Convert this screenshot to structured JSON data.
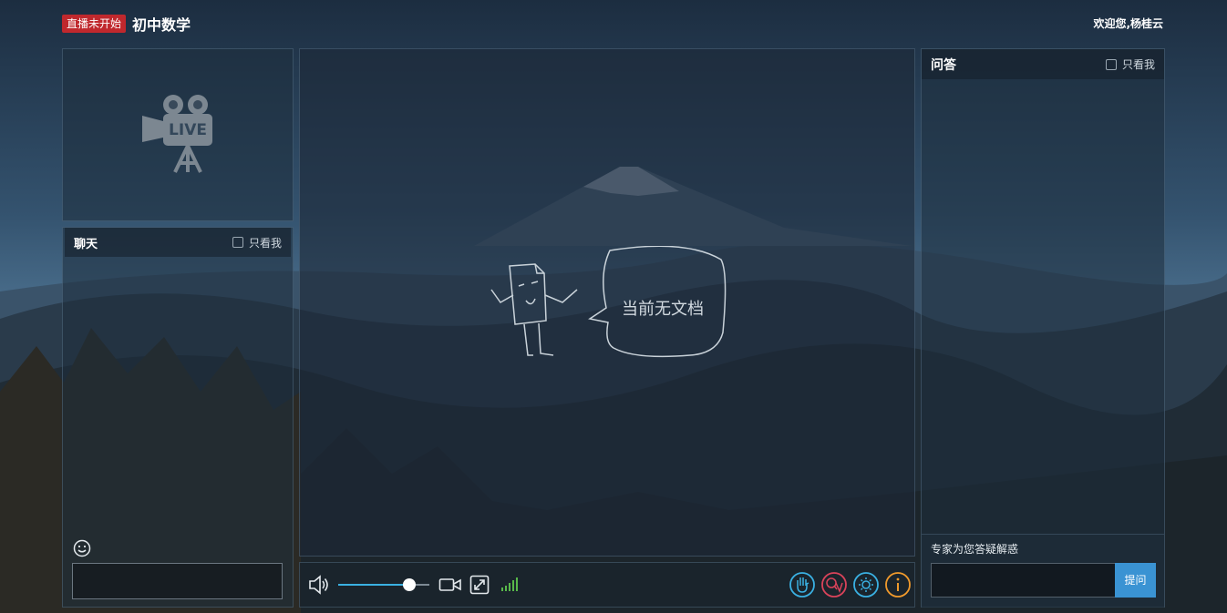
{
  "header": {
    "status_badge": "直播未开始",
    "course_title": "初中数学",
    "welcome": "欢迎您,杨桂云"
  },
  "video": {
    "icon": "live-camera-icon",
    "icon_text": "LIVE"
  },
  "chat": {
    "title": "聊天",
    "only_me_label": "只看我",
    "only_me_checked": false,
    "input_value": "",
    "emoji_icon": "smiley-icon"
  },
  "document": {
    "empty_text": "当前无文档",
    "illustration": "document-character-icon"
  },
  "controls": {
    "volume_level": 0.78,
    "icons": [
      "speaker-icon",
      "camera-icon",
      "fullscreen-icon",
      "signal-icon"
    ],
    "action_icons": [
      "raise-hand-icon",
      "qa-icon",
      "brightness-icon",
      "info-icon"
    ],
    "colors": {
      "accent": "#3ab0e2",
      "raise_hand": "#3ab0e2",
      "qa": "#d9435a",
      "brightness": "#3ab0e2",
      "info": "#f09a2c",
      "signal": "#58b84a"
    }
  },
  "qa": {
    "title": "问答",
    "only_me_label": "只看我",
    "only_me_checked": false,
    "hint": "专家为您答疑解惑",
    "input_value": "",
    "ask_button_label": "提问"
  }
}
